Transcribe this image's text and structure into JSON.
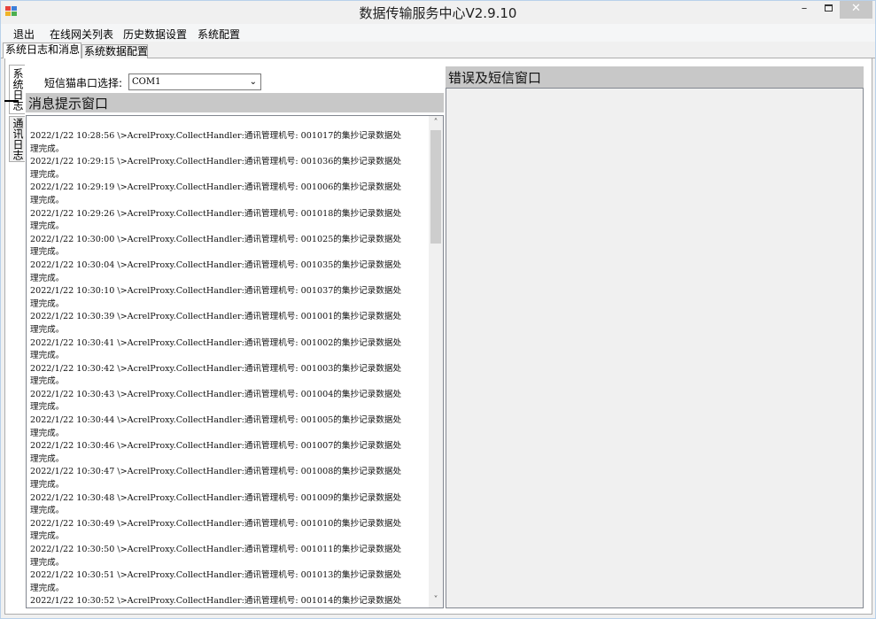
{
  "window": {
    "title": "数据传输服务中心V2.9.10"
  },
  "title_buttons": {
    "minimize": "–",
    "close": "✕"
  },
  "menu": {
    "items": [
      {
        "label": "退出"
      },
      {
        "label": "在线网关列表"
      },
      {
        "label": "历史数据设置"
      },
      {
        "label": "系统配置"
      }
    ]
  },
  "tabs": {
    "items": [
      {
        "label": "系统日志和消息",
        "selected": true
      },
      {
        "label": "系统数据配置",
        "selected": false
      }
    ]
  },
  "side_tabs": {
    "items": [
      {
        "label": "系统日志",
        "selected": true
      },
      {
        "label": "通讯日志",
        "selected": false
      }
    ]
  },
  "sms_port": {
    "label": "短信猫串口选择:",
    "value": "COM1"
  },
  "message_panel": {
    "title": "消息提示窗口",
    "lines": [
      "2022/1/22 10:28:56 \\>AcrelProxy.CollectHandler:通讯管理机号: 001017的集抄记录数据处",
      "理完成。",
      "2022/1/22 10:29:15 \\>AcrelProxy.CollectHandler:通讯管理机号: 001036的集抄记录数据处",
      "理完成。",
      "2022/1/22 10:29:19 \\>AcrelProxy.CollectHandler:通讯管理机号: 001006的集抄记录数据处",
      "理完成。",
      "2022/1/22 10:29:26 \\>AcrelProxy.CollectHandler:通讯管理机号: 001018的集抄记录数据处",
      "理完成。",
      "2022/1/22 10:30:00 \\>AcrelProxy.CollectHandler:通讯管理机号: 001025的集抄记录数据处",
      "理完成。",
      "2022/1/22 10:30:04 \\>AcrelProxy.CollectHandler:通讯管理机号: 001035的集抄记录数据处",
      "理完成。",
      "2022/1/22 10:30:10 \\>AcrelProxy.CollectHandler:通讯管理机号: 001037的集抄记录数据处",
      "理完成。",
      "2022/1/22 10:30:39 \\>AcrelProxy.CollectHandler:通讯管理机号: 001001的集抄记录数据处",
      "理完成。",
      "2022/1/22 10:30:41 \\>AcrelProxy.CollectHandler:通讯管理机号: 001002的集抄记录数据处",
      "理完成。",
      "2022/1/22 10:30:42 \\>AcrelProxy.CollectHandler:通讯管理机号: 001003的集抄记录数据处",
      "理完成。",
      "2022/1/22 10:30:43 \\>AcrelProxy.CollectHandler:通讯管理机号: 001004的集抄记录数据处",
      "理完成。",
      "2022/1/22 10:30:44 \\>AcrelProxy.CollectHandler:通讯管理机号: 001005的集抄记录数据处",
      "理完成。",
      "2022/1/22 10:30:46 \\>AcrelProxy.CollectHandler:通讯管理机号: 001007的集抄记录数据处",
      "理完成。",
      "2022/1/22 10:30:47 \\>AcrelProxy.CollectHandler:通讯管理机号: 001008的集抄记录数据处",
      "理完成。",
      "2022/1/22 10:30:48 \\>AcrelProxy.CollectHandler:通讯管理机号: 001009的集抄记录数据处",
      "理完成。",
      "2022/1/22 10:30:49 \\>AcrelProxy.CollectHandler:通讯管理机号: 001010的集抄记录数据处",
      "理完成。",
      "2022/1/22 10:30:50 \\>AcrelProxy.CollectHandler:通讯管理机号: 001011的集抄记录数据处",
      "理完成。",
      "2022/1/22 10:30:51 \\>AcrelProxy.CollectHandler:通讯管理机号: 001013的集抄记录数据处",
      "理完成。",
      "2022/1/22 10:30:52 \\>AcrelProxy.CollectHandler:通讯管理机号: 001014的集抄记录数据处"
    ]
  },
  "error_panel": {
    "title": "错误及短信窗口"
  }
}
